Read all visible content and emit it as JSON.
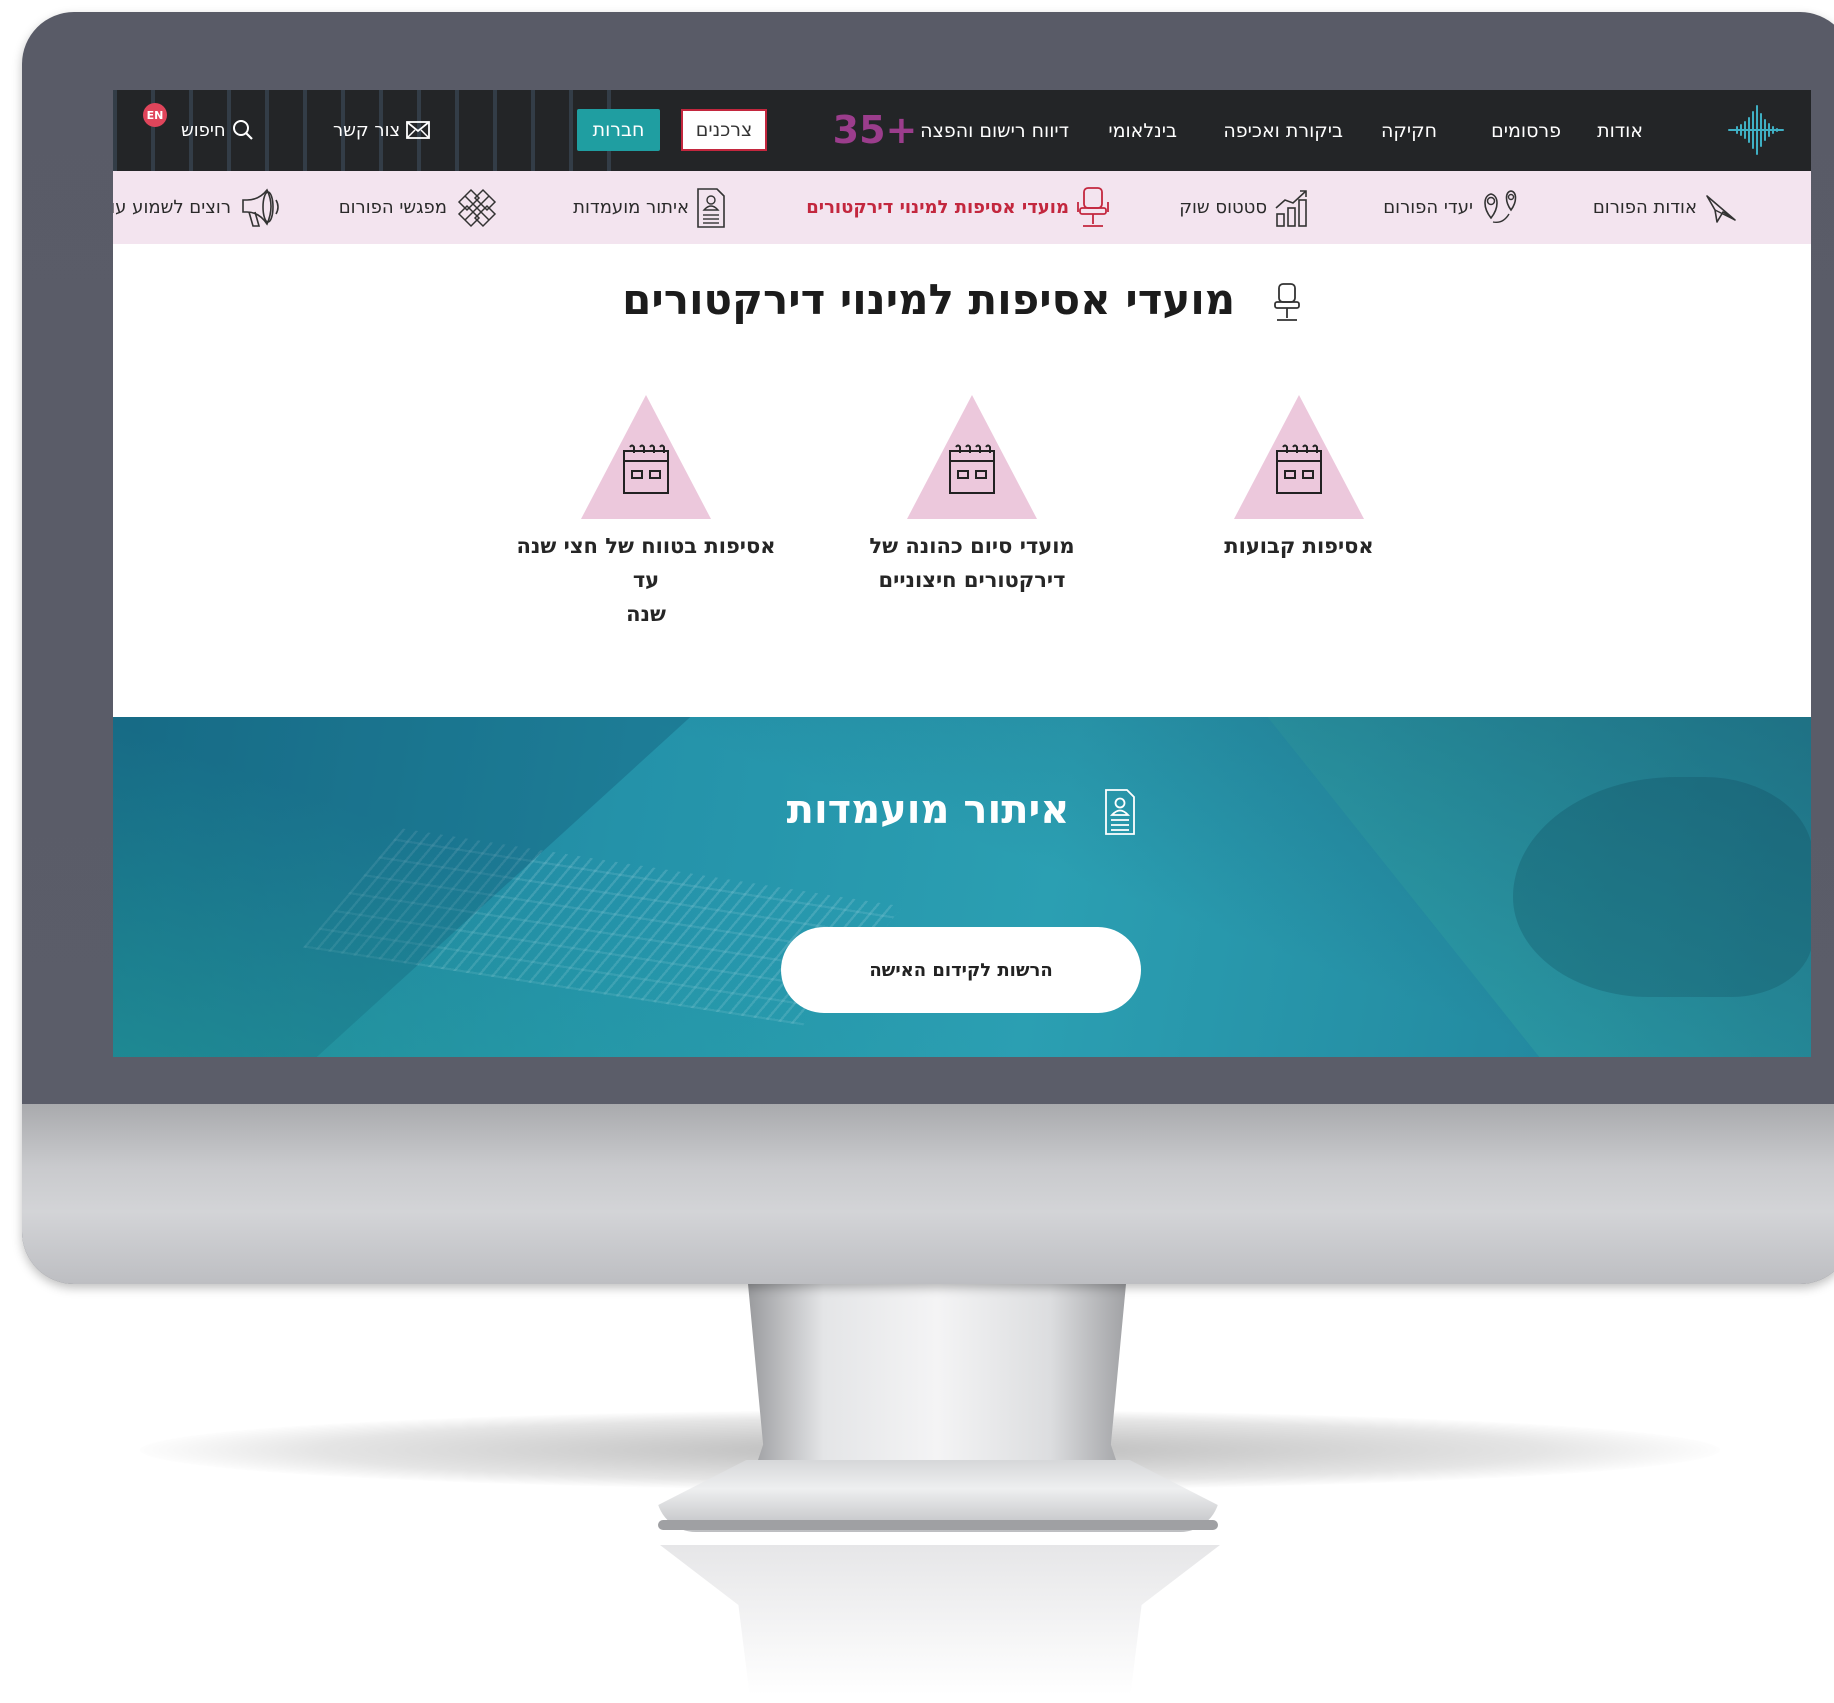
{
  "top_nav": {
    "items": [
      "אודות",
      "פרסומים",
      "חקיקה",
      "ביקורת ואכיפה",
      "בינלאומי",
      "דיווח רישום והפצה"
    ],
    "badge_35": "+35",
    "consumers_button": "צרכנים",
    "organizations_button": "חברות",
    "contact": "צור קשר",
    "search": "חיפוש",
    "language": "EN"
  },
  "sub_nav": {
    "items": [
      {
        "label": "אודות הפורום",
        "icon": "paper-plane-icon"
      },
      {
        "label": "יעדי הפורום",
        "icon": "map-pin-icon"
      },
      {
        "label": "סטטוס שוק",
        "icon": "bar-chart-icon"
      },
      {
        "label": "מועדי אסיפות למינוי דירקטורים",
        "icon": "office-chair-icon",
        "active": true
      },
      {
        "label": "איתור מועמדות",
        "icon": "resume-document-icon"
      },
      {
        "label": "מפגשי הפורום",
        "icon": "handshake-icon"
      },
      {
        "label": "רוצים לשמוע עוד",
        "icon": "megaphone-icon"
      }
    ]
  },
  "main": {
    "title": "מועדי אסיפות למינוי דירקטורים",
    "cards": [
      {
        "label_1": "אסיפות קבועות",
        "label_2": ""
      },
      {
        "label_1": "מועדי סיום כהונה של",
        "label_2": "דירקטורים חיצוניים"
      },
      {
        "label_1": "אסיפות בטווח של חצי שנה עד",
        "label_2": "שנה"
      }
    ]
  },
  "banner": {
    "title": "איתור מועמדות",
    "cta": "הרשות לקידום האישה"
  },
  "colors": {
    "accent_red": "#c3273e",
    "teal": "#1f9ea1",
    "topbar": "#232527",
    "subbar": "#f3e4ef",
    "triangle_pink": "#ecc8dc"
  }
}
